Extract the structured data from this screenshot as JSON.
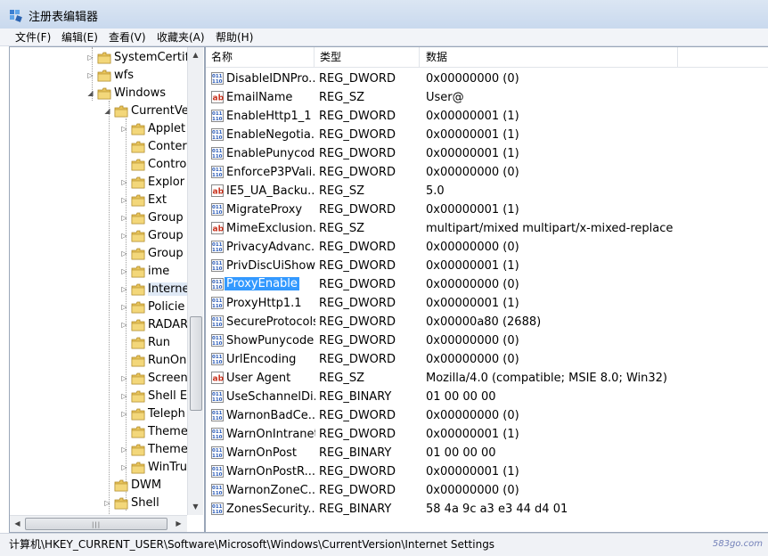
{
  "window": {
    "title": "注册表编辑器"
  },
  "menu": [
    "文件(F)",
    "编辑(E)",
    "查看(V)",
    "收藏夹(A)",
    "帮助(H)"
  ],
  "tree": [
    {
      "label": "SystemCertifi",
      "level": 1,
      "expander": "closed"
    },
    {
      "label": "wfs",
      "level": 1,
      "expander": "closed"
    },
    {
      "label": "Windows",
      "level": 1,
      "expander": "open"
    },
    {
      "label": "CurrentVe",
      "level": 2,
      "expander": "open"
    },
    {
      "label": "Applet",
      "level": 3,
      "expander": "closed"
    },
    {
      "label": "Conter",
      "level": 3,
      "expander": "none"
    },
    {
      "label": "Contro",
      "level": 3,
      "expander": "none"
    },
    {
      "label": "Explor",
      "level": 3,
      "expander": "closed"
    },
    {
      "label": "Ext",
      "level": 3,
      "expander": "closed"
    },
    {
      "label": "Group",
      "level": 3,
      "expander": "closed"
    },
    {
      "label": "Group",
      "level": 3,
      "expander": "closed"
    },
    {
      "label": "Group",
      "level": 3,
      "expander": "closed"
    },
    {
      "label": "ime",
      "level": 3,
      "expander": "closed"
    },
    {
      "label": "Interne",
      "level": 3,
      "expander": "closed",
      "selected": true
    },
    {
      "label": "Policie",
      "level": 3,
      "expander": "closed"
    },
    {
      "label": "RADAR",
      "level": 3,
      "expander": "closed"
    },
    {
      "label": "Run",
      "level": 3,
      "expander": "none"
    },
    {
      "label": "RunOn",
      "level": 3,
      "expander": "none"
    },
    {
      "label": "Screen",
      "level": 3,
      "expander": "closed"
    },
    {
      "label": "Shell E",
      "level": 3,
      "expander": "closed"
    },
    {
      "label": "Teleph",
      "level": 3,
      "expander": "closed"
    },
    {
      "label": "Theme",
      "level": 3,
      "expander": "none"
    },
    {
      "label": "Theme",
      "level": 3,
      "expander": "closed"
    },
    {
      "label": "WinTru",
      "level": 3,
      "expander": "closed"
    },
    {
      "label": "DWM",
      "level": 2,
      "expander": "none"
    },
    {
      "label": "Shell",
      "level": 2,
      "expander": "closed"
    }
  ],
  "list": {
    "headers": {
      "name": "名称",
      "type": "类型",
      "data": "数据"
    },
    "rows": [
      {
        "icon": "dword",
        "name": "DisableIDNPro...",
        "type": "REG_DWORD",
        "data": "0x00000000 (0)"
      },
      {
        "icon": "string",
        "name": "EmailName",
        "type": "REG_SZ",
        "data": "User@"
      },
      {
        "icon": "dword",
        "name": "EnableHttp1_1",
        "type": "REG_DWORD",
        "data": "0x00000001 (1)"
      },
      {
        "icon": "dword",
        "name": "EnableNegotia...",
        "type": "REG_DWORD",
        "data": "0x00000001 (1)"
      },
      {
        "icon": "dword",
        "name": "EnablePunycode",
        "type": "REG_DWORD",
        "data": "0x00000001 (1)"
      },
      {
        "icon": "dword",
        "name": "EnforceP3PVali...",
        "type": "REG_DWORD",
        "data": "0x00000000 (0)"
      },
      {
        "icon": "string",
        "name": "IE5_UA_Backu...",
        "type": "REG_SZ",
        "data": "5.0"
      },
      {
        "icon": "dword",
        "name": "MigrateProxy",
        "type": "REG_DWORD",
        "data": "0x00000001 (1)"
      },
      {
        "icon": "string",
        "name": "MimeExclusion...",
        "type": "REG_SZ",
        "data": "multipart/mixed multipart/x-mixed-replace m..."
      },
      {
        "icon": "dword",
        "name": "PrivacyAdvanc...",
        "type": "REG_DWORD",
        "data": "0x00000000 (0)"
      },
      {
        "icon": "dword",
        "name": "PrivDiscUiShown",
        "type": "REG_DWORD",
        "data": "0x00000001 (1)"
      },
      {
        "icon": "dword",
        "name": "ProxyEnable",
        "type": "REG_DWORD",
        "data": "0x00000000 (0)",
        "selected": true
      },
      {
        "icon": "dword",
        "name": "ProxyHttp1.1",
        "type": "REG_DWORD",
        "data": "0x00000001 (1)"
      },
      {
        "icon": "dword",
        "name": "SecureProtocols",
        "type": "REG_DWORD",
        "data": "0x00000a80 (2688)"
      },
      {
        "icon": "dword",
        "name": "ShowPunycode",
        "type": "REG_DWORD",
        "data": "0x00000000 (0)"
      },
      {
        "icon": "dword",
        "name": "UrlEncoding",
        "type": "REG_DWORD",
        "data": "0x00000000 (0)"
      },
      {
        "icon": "string",
        "name": "User Agent",
        "type": "REG_SZ",
        "data": "Mozilla/4.0 (compatible; MSIE 8.0; Win32)"
      },
      {
        "icon": "dword",
        "name": "UseSchannelDi...",
        "type": "REG_BINARY",
        "data": "01 00 00 00"
      },
      {
        "icon": "dword",
        "name": "WarnonBadCe...",
        "type": "REG_DWORD",
        "data": "0x00000000 (0)"
      },
      {
        "icon": "dword",
        "name": "WarnOnIntranet",
        "type": "REG_DWORD",
        "data": "0x00000001 (1)"
      },
      {
        "icon": "dword",
        "name": "WarnOnPost",
        "type": "REG_BINARY",
        "data": "01 00 00 00"
      },
      {
        "icon": "dword",
        "name": "WarnOnPostR...",
        "type": "REG_DWORD",
        "data": "0x00000001 (1)"
      },
      {
        "icon": "dword",
        "name": "WarnonZoneC...",
        "type": "REG_DWORD",
        "data": "0x00000000 (0)"
      },
      {
        "icon": "dword",
        "name": "ZonesSecurity...",
        "type": "REG_BINARY",
        "data": "58 4a 9c a3 e3 44 d4 01"
      }
    ]
  },
  "status": {
    "path": "计算机\\HKEY_CURRENT_USER\\Software\\Microsoft\\Windows\\CurrentVersion\\Internet Settings",
    "watermark": "583go.com"
  },
  "colors": {
    "selection": "#3399ff",
    "folder": "#e8c45a"
  }
}
